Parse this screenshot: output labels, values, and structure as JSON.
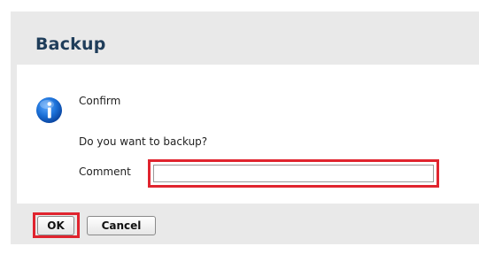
{
  "dialog": {
    "title": "Backup",
    "icon": "info-icon",
    "confirm_label": "Confirm",
    "question": "Do you want to backup?",
    "comment_label": "Comment",
    "comment_value": "",
    "ok_label": "OK",
    "cancel_label": "Cancel"
  },
  "colors": {
    "title_text": "#1f3d5a",
    "highlight": "#e0242e",
    "panel": "#e9e9e9",
    "icon_blue": "#1a6fd6"
  }
}
